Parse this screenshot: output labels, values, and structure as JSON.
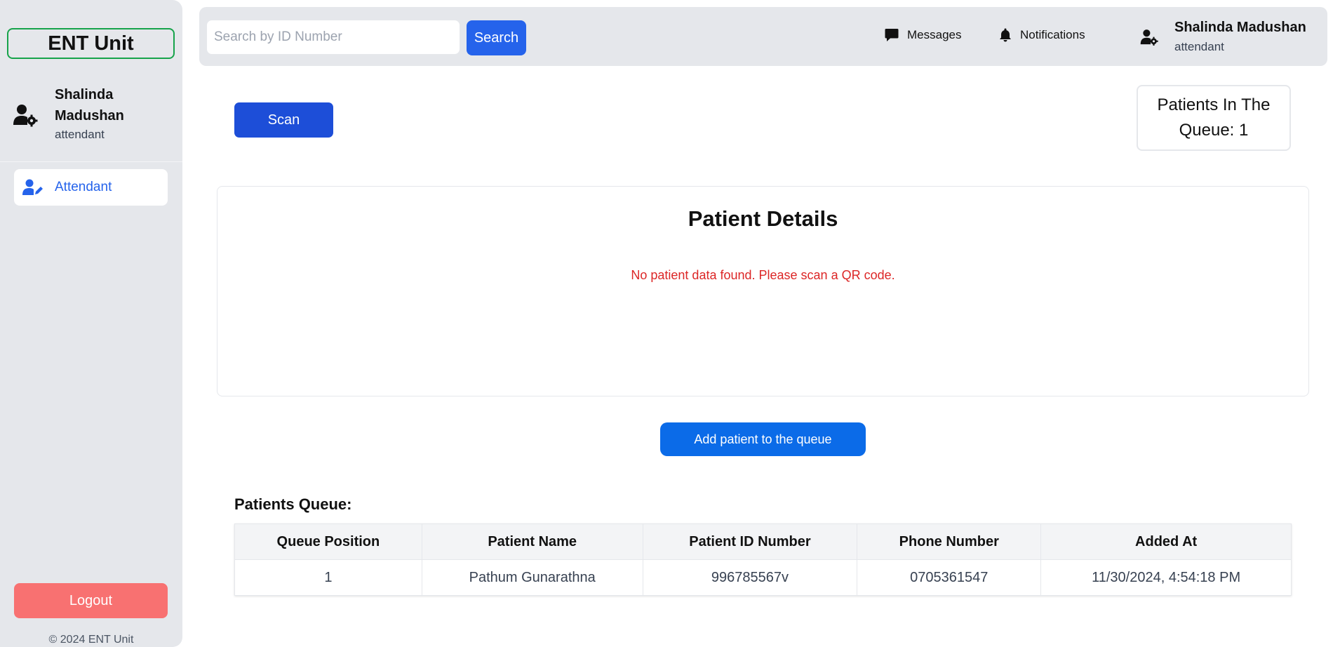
{
  "sidebar": {
    "brand": "ENT Unit",
    "user": {
      "name": "Shalinda Madushan",
      "role": "attendant"
    },
    "nav": [
      {
        "label": "Attendant",
        "icon": "user-edit-icon"
      }
    ],
    "logout_label": "Logout",
    "copyright": "© 2024 ENT Unit"
  },
  "topbar": {
    "search_placeholder": "Search by ID Number",
    "search_value": "",
    "search_label": "Search",
    "messages_label": "Messages",
    "notifications_label": "Notifications",
    "user": {
      "name": "Shalinda Madushan",
      "role": "attendant"
    }
  },
  "main": {
    "scan_label": "Scan",
    "queue_count_text": "Patients In The Queue: 1",
    "details_title": "Patient Details",
    "details_empty": "No patient data found. Please scan a QR code.",
    "add_label": "Add patient to the queue",
    "queue_title": "Patients Queue:",
    "queue_columns": [
      "Queue Position",
      "Patient Name",
      "Patient ID Number",
      "Phone Number",
      "Added At"
    ],
    "queue_rows": [
      [
        "1",
        "Pathum Gunarathna",
        "996785567v",
        "0705361547",
        "11/30/2024, 4:54:18 PM"
      ]
    ]
  },
  "colors": {
    "primary": "#2563eb",
    "scan": "#1d4ed8",
    "add": "#0b6be8",
    "logout": "#f87171",
    "error": "#dc2626",
    "brand_border": "#16a34a",
    "sidebar_bg": "#e5e7eb"
  }
}
